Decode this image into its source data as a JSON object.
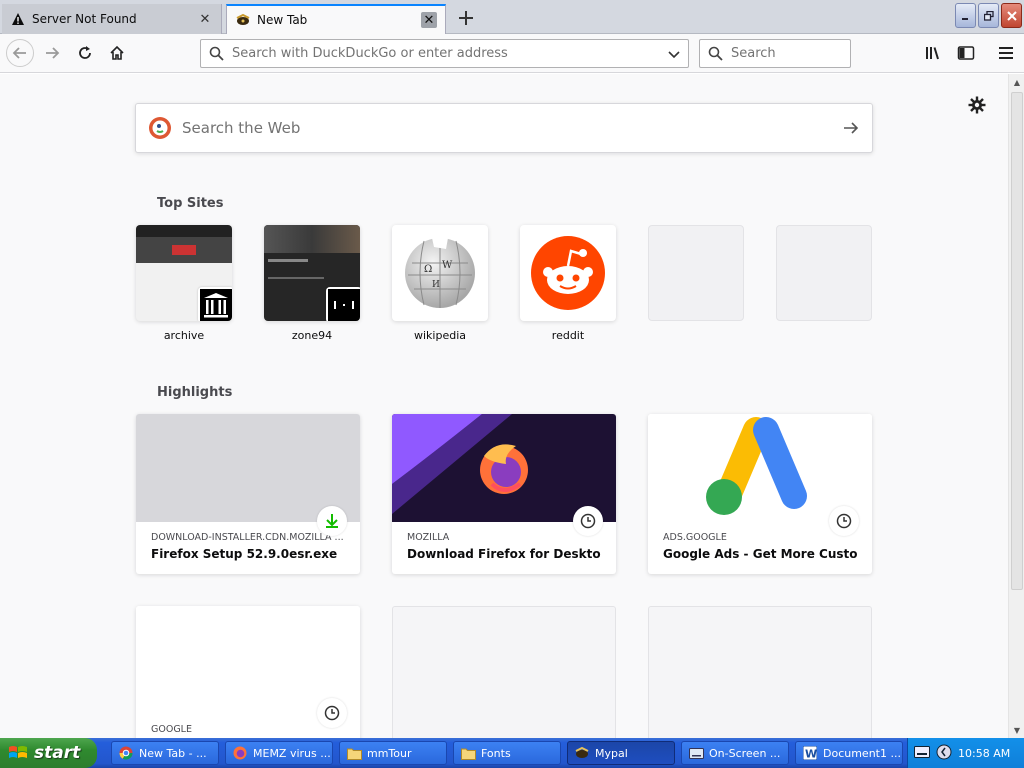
{
  "tabs": [
    {
      "label": "Server Not Found",
      "icon": "warning-icon",
      "active": false
    },
    {
      "label": "New Tab",
      "icon": "mypal-icon",
      "active": true
    }
  ],
  "navbar": {
    "url_placeholder": "Search with DuckDuckGo or enter address",
    "search_placeholder": "Search"
  },
  "page": {
    "websearch_placeholder": "Search the Web",
    "top_sites_title": "Top Sites",
    "highlights_title": "Highlights",
    "top_sites": [
      {
        "label": "archive"
      },
      {
        "label": "zone94"
      },
      {
        "label": "wikipedia"
      },
      {
        "label": "reddit"
      },
      {
        "label": ""
      },
      {
        "label": ""
      }
    ],
    "highlights": [
      {
        "host": "DOWNLOAD-INSTALLER.CDN.MOZILLA ...",
        "title": "Firefox Setup 52.9.0esr.exe",
        "badge": "download-icon"
      },
      {
        "host": "MOZILLA",
        "title": "Download Firefox for Desktop ...",
        "badge": "clock-icon"
      },
      {
        "host": "ADS.GOOGLE",
        "title": "Google Ads - Get More Custome...",
        "badge": "clock-icon"
      },
      {
        "host": "GOOGLE",
        "title": "",
        "badge": "clock-icon"
      }
    ]
  },
  "taskbar": {
    "start_label": "start",
    "tasks": [
      {
        "label": "New Tab - ...",
        "icon": "chrome-icon",
        "active": false
      },
      {
        "label": "MEMZ virus ...",
        "icon": "firefox-icon",
        "active": false
      },
      {
        "label": "mmTour",
        "icon": "folder-icon",
        "active": false
      },
      {
        "label": "Fonts",
        "icon": "folder-icon",
        "active": false
      },
      {
        "label": "Mypal",
        "icon": "mypal-icon",
        "active": true
      },
      {
        "label": "On-Screen ...",
        "icon": "keyboard-icon",
        "active": false
      },
      {
        "label": "Document1 ...",
        "icon": "word-icon",
        "active": false
      }
    ],
    "clock": "10:58 AM"
  },
  "colors": {
    "accent": "#0a84ff",
    "reddit": "#ff4500",
    "taskbar": "#245edb",
    "start": "#3c9b3c"
  }
}
